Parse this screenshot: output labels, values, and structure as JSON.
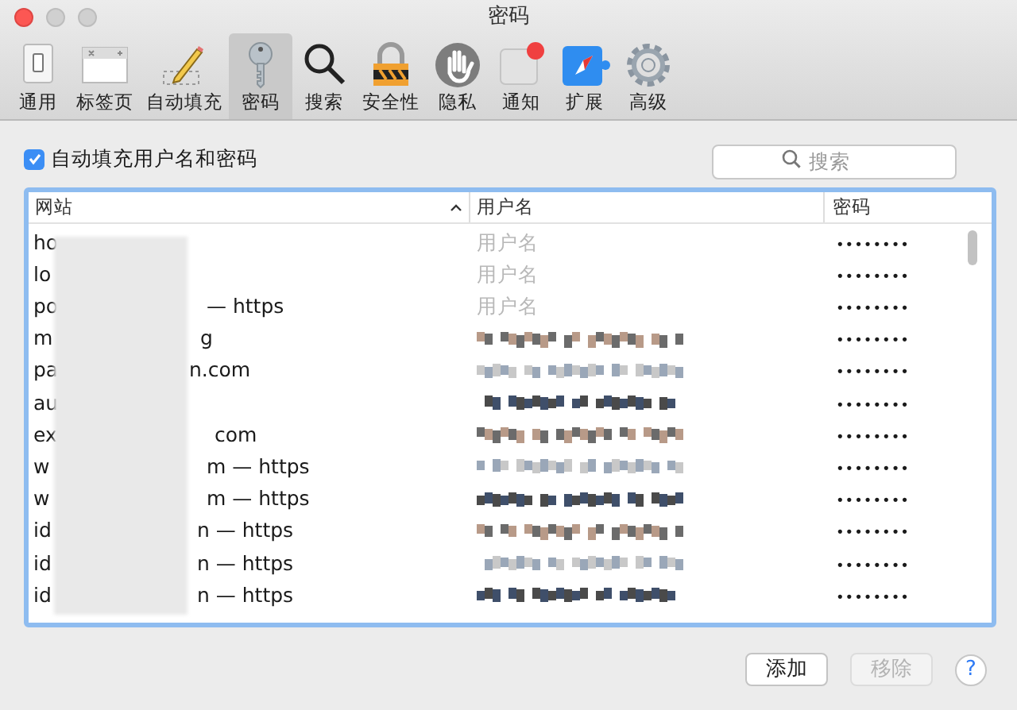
{
  "window": {
    "title": "密码"
  },
  "toolbar": [
    {
      "label": "通用",
      "kind": "switch",
      "selected": false
    },
    {
      "label": "标签页",
      "kind": "tabs",
      "selected": false
    },
    {
      "label": "自动填充",
      "kind": "pencil",
      "selected": false
    },
    {
      "label": "密码",
      "kind": "key",
      "selected": true
    },
    {
      "label": "搜索",
      "kind": "magnifier",
      "selected": false
    },
    {
      "label": "安全性",
      "kind": "lock",
      "selected": false
    },
    {
      "label": "隐私",
      "kind": "hand",
      "selected": false
    },
    {
      "label": "通知",
      "kind": "notify",
      "selected": false
    },
    {
      "label": "扩展",
      "kind": "compass",
      "selected": false
    },
    {
      "label": "高级",
      "kind": "gear",
      "selected": false
    }
  ],
  "autofill": {
    "label": "自动填充用户名和密码",
    "checked": true
  },
  "search": {
    "placeholder": "搜索"
  },
  "table": {
    "columns": [
      {
        "label": "网站",
        "sorted": true
      },
      {
        "label": "用户名",
        "sorted": false
      },
      {
        "label": "密码",
        "sorted": false
      }
    ],
    "rows": [
      {
        "site_start": "ho",
        "site_end": "",
        "username": {
          "kind": "placeholder",
          "placeholder": "用户名"
        },
        "password": "••••••••"
      },
      {
        "site_start": "lo",
        "site_end": "",
        "username": {
          "kind": "placeholder",
          "placeholder": "用户名"
        },
        "password": "••••••••"
      },
      {
        "site_start": "po",
        "site_end": "— https",
        "username": {
          "kind": "placeholder",
          "placeholder": "用户名"
        },
        "password": "••••••••"
      },
      {
        "site_start": "m",
        "site_end": "g",
        "username": {
          "kind": "pixelated"
        },
        "password": "••••••••"
      },
      {
        "site_start": "pa",
        "site_end": "n.com",
        "username": {
          "kind": "pixelated"
        },
        "password": "••••••••"
      },
      {
        "site_start": "au",
        "site_end": "",
        "username": {
          "kind": "pixelated"
        },
        "password": "••••••••"
      },
      {
        "site_start": "ex",
        "site_end": "com",
        "username": {
          "kind": "pixelated"
        },
        "password": "••••••••"
      },
      {
        "site_start": "w",
        "site_end": "m — https",
        "username": {
          "kind": "pixelated"
        },
        "password": "••••••••"
      },
      {
        "site_start": "w",
        "site_end": "m — https",
        "username": {
          "kind": "pixelated"
        },
        "password": "••••••••"
      },
      {
        "site_start": "id",
        "site_end": "n — https",
        "username": {
          "kind": "pixelated"
        },
        "password": "••••••••"
      },
      {
        "site_start": "id",
        "site_end": "n — https",
        "username": {
          "kind": "pixelated"
        },
        "password": "••••••••"
      },
      {
        "site_start": "id",
        "site_end": "n — https",
        "username": {
          "kind": "pixelated"
        },
        "password": "••••••••"
      }
    ]
  },
  "buttons": [
    {
      "label": "添加",
      "disabled": false
    },
    {
      "label": "移除",
      "disabled": true
    }
  ],
  "help": {
    "label": "?"
  }
}
